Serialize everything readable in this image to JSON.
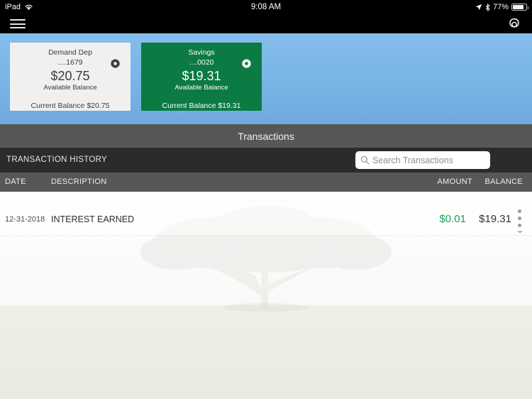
{
  "status_bar": {
    "carrier": "iPad",
    "wifi_icon": "wifi-icon",
    "time": "9:08 AM",
    "location_icon": "location-arrow-icon",
    "bluetooth_icon": "bluetooth-icon",
    "battery_percent": "77%",
    "battery_icon": "battery-icon"
  },
  "nav_bar": {
    "menu_icon": "hamburger-menu-icon",
    "settings_icon": "gear-icon"
  },
  "accounts": [
    {
      "name": "Demand Dep",
      "mask": "....1679",
      "available_amount": "$20.75",
      "available_label": "Available Balance",
      "current_balance": "Current Balance $20.75",
      "gear_icon": "gear-icon",
      "theme": "white",
      "color": "#f0f0f0"
    },
    {
      "name": "Savings",
      "mask": "....0020",
      "available_amount": "$19.31",
      "available_label": "Available Balance",
      "current_balance": "Current Balance $19.31",
      "gear_icon": "gear-icon",
      "theme": "green",
      "color": "#0b7a43"
    }
  ],
  "section": {
    "title": "Transactions"
  },
  "history": {
    "label": "TRANSACTION HISTORY",
    "search_placeholder": "Search Transactions",
    "search_value": "",
    "search_icon": "search-icon"
  },
  "table": {
    "columns": {
      "date": "DATE",
      "description": "DESCRIPTION",
      "amount": "AMOUNT",
      "balance": "BALANCE"
    },
    "rows": [
      {
        "date": "12-31-2018",
        "description": "INTEREST EARNED",
        "amount": "$0.01",
        "balance": "$19.31",
        "amount_color": "#17a05a",
        "menu_icon": "more-vertical-icon",
        "expand_icon": "chevron-down-icon"
      }
    ]
  },
  "theme": {
    "header_blue": "#79b4e6",
    "bar_gray": "#575757",
    "dark_bar": "#2b2b2b",
    "accent_green": "#0b7a43",
    "positive_green": "#17a05a"
  }
}
